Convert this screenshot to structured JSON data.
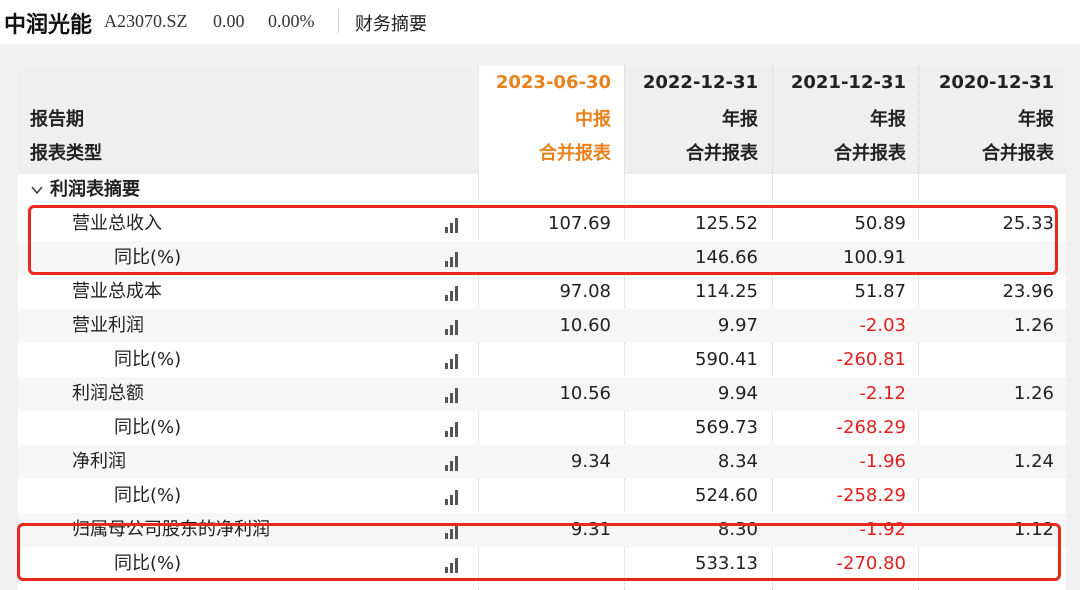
{
  "header": {
    "stock_name": "中润光能",
    "stock_code": "A23070.SZ",
    "price": "0.00",
    "change_pct": "0.00%",
    "section": "财务摘要"
  },
  "table": {
    "row_label_period": "报告期",
    "row_label_type": "报表类型",
    "columns": [
      {
        "date": "2023-06-30",
        "period": "中报",
        "type": "合并报表",
        "highlight": true
      },
      {
        "date": "2022-12-31",
        "period": "年报",
        "type": "合并报表",
        "highlight": false
      },
      {
        "date": "2021-12-31",
        "period": "年报",
        "type": "合并报表",
        "highlight": false
      },
      {
        "date": "2020-12-31",
        "period": "年报",
        "type": "合并报表",
        "highlight": false
      }
    ],
    "section_title": "利润表摘要",
    "rows": [
      {
        "label": "营业总收入",
        "level": 1,
        "values": [
          "107.69",
          "125.52",
          "50.89",
          "25.33"
        ]
      },
      {
        "label": "同比(%)",
        "level": 2,
        "values": [
          "",
          "146.66",
          "100.91",
          ""
        ]
      },
      {
        "label": "营业总成本",
        "level": 1,
        "values": [
          "97.08",
          "114.25",
          "51.87",
          "23.96"
        ]
      },
      {
        "label": "营业利润",
        "level": 1,
        "values": [
          "10.60",
          "9.97",
          "-2.03",
          "1.26"
        ]
      },
      {
        "label": "同比(%)",
        "level": 2,
        "values": [
          "",
          "590.41",
          "-260.81",
          ""
        ]
      },
      {
        "label": "利润总额",
        "level": 1,
        "values": [
          "10.56",
          "9.94",
          "-2.12",
          "1.26"
        ]
      },
      {
        "label": "同比(%)",
        "level": 2,
        "values": [
          "",
          "569.73",
          "-268.29",
          ""
        ]
      },
      {
        "label": "净利润",
        "level": 1,
        "values": [
          "9.34",
          "8.34",
          "-1.96",
          "1.24"
        ]
      },
      {
        "label": "同比(%)",
        "level": 2,
        "values": [
          "",
          "524.60",
          "-258.29",
          ""
        ]
      },
      {
        "label": "归属母公司股东的净利润",
        "level": 1,
        "values": [
          "9.31",
          "8.30",
          "-1.92",
          "1.12"
        ]
      },
      {
        "label": "同比(%)",
        "level": 2,
        "values": [
          "",
          "533.13",
          "-270.80",
          ""
        ]
      }
    ]
  },
  "icons": {
    "chart": "bar-chart-icon",
    "caret": "chevron-down-icon"
  },
  "colors": {
    "accent": "#e8821c",
    "negative": "#e02020",
    "highlight_box": "#e8291c"
  }
}
